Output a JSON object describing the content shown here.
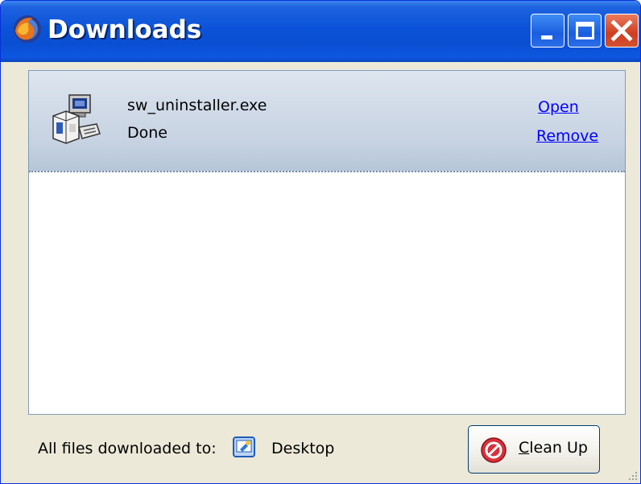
{
  "window": {
    "title": "Downloads"
  },
  "downloads": [
    {
      "file_name": "sw_uninstaller.exe",
      "status": "Done",
      "actions": {
        "open": "Open",
        "remove": "Remove"
      },
      "icon": "installer-icon"
    }
  ],
  "footer": {
    "label": "All files downloaded to:",
    "folder": "Desktop",
    "folder_icon": "desktop-icon",
    "cleanup_button": {
      "accel_letter": "C",
      "label_rest": "lean Up",
      "icon": "no-entry-icon"
    }
  },
  "colors": {
    "titlebar": "#0a52d8",
    "link": "#0000ff",
    "window_bg": "#ece9d8"
  }
}
